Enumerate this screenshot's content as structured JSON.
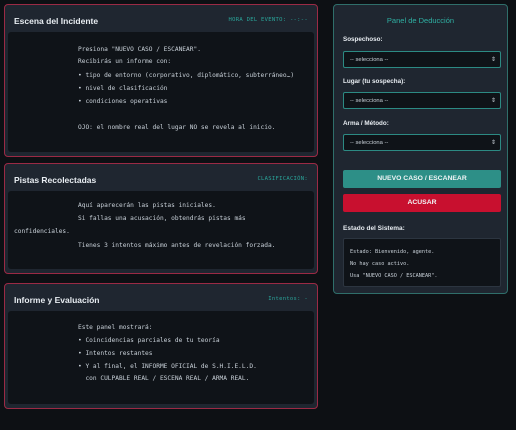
{
  "scene": {
    "title": "Escena del Incidente",
    "tag": "HORA DEL EVENTO: --:--",
    "lines": [
      "Presiona \"NUEVO CASO / ESCANEAR\".",
      "Recibirás un informe con:",
      "• tipo de entorno (corporativo, diplomático, subterráneo…)",
      "• nivel de clasificación",
      "• condiciones operativas",
      "",
      "OJO: el nombre real del lugar NO se revela al inicio."
    ]
  },
  "clues": {
    "title": "Pistas Recolectadas",
    "tag": "CLASIFICACIÓN:",
    "line1": "Aquí aparecerán las pistas iniciales.",
    "line2": "Si fallas una acusación, obtendrás pistas más",
    "line3": "confidenciales.",
    "line4": "Tienes 3 intentos máximo antes de revelación forzada."
  },
  "report": {
    "title": "Informe y Evaluación",
    "tag": "Intentos: -",
    "lines": [
      "Este panel mostrará:",
      "• Coincidencias parciales de tu teoría",
      "• Intentos restantes",
      "• Y al final, el INFORME OFICIAL de S.H.I.E.L.D.",
      "  con CULPABLE REAL / ESCENA REAL / ARMA REAL."
    ]
  },
  "deduction": {
    "title": "Panel de Deducción",
    "suspect_label": "Sospechoso:",
    "place_label": "Lugar (tu sospecha):",
    "weapon_label": "Arma / Método:",
    "select_value": "-- selecciona --",
    "new_case_label": "NUEVO CASO / ESCANEAR",
    "accuse_label": "ACUSAR",
    "status_label": "Estado del Sistema:",
    "status_lines": [
      "Estado: Bienvenido, agente.",
      "No hay caso activo.",
      "Usa \"NUEVO CASO / ESCANEAR\"."
    ]
  },
  "colors": {
    "accent": "#2fb0a3",
    "danger": "#c8102f",
    "panel_border": "#9b2a45"
  }
}
